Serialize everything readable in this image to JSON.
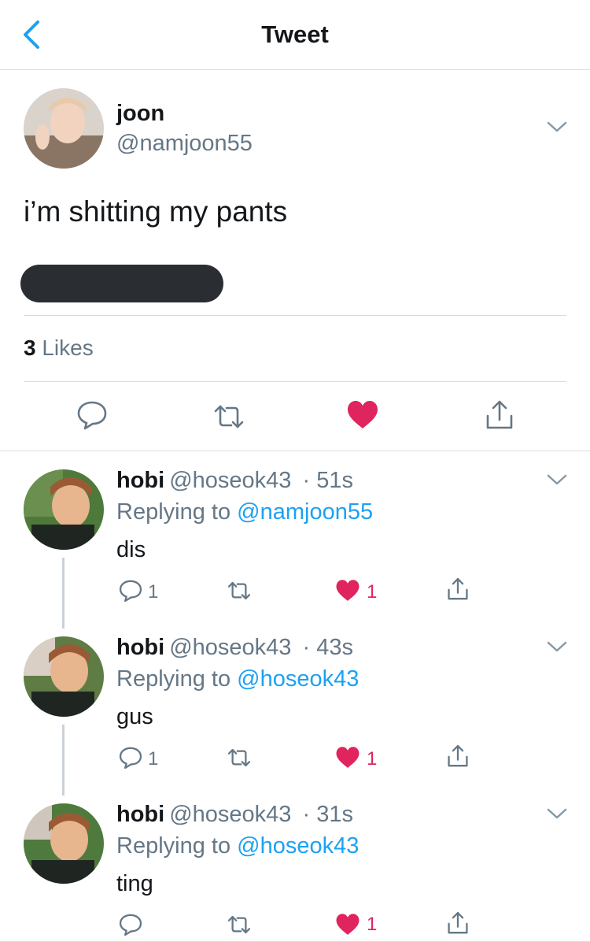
{
  "header": {
    "title": "Tweet",
    "back_icon": "chevron-left-icon"
  },
  "tweet": {
    "author_name": "joon",
    "author_handle": "@namjoon55",
    "text": "i’m shitting my pants",
    "likes_count": "3",
    "likes_label": "Likes",
    "liked": true,
    "actions": [
      "reply-icon",
      "retweet-icon",
      "heart-icon",
      "share-icon"
    ]
  },
  "replies": [
    {
      "name": "hobi",
      "handle": "@hoseok43",
      "time": "· 51s",
      "replying_label": "Replying to",
      "replying_to": "@namjoon55",
      "text": "dis",
      "reply_count": "1",
      "like_count": "1"
    },
    {
      "name": "hobi",
      "handle": "@hoseok43",
      "time": "· 43s",
      "replying_label": "Replying to",
      "replying_to": "@hoseok43",
      "text": "gus",
      "reply_count": "1",
      "like_count": "1"
    },
    {
      "name": "hobi",
      "handle": "@hoseok43",
      "time": "· 31s",
      "replying_label": "Replying to",
      "replying_to": "@hoseok43",
      "text": "ting",
      "reply_count": "",
      "like_count": "1"
    }
  ],
  "colors": {
    "accent": "#1da1f2",
    "like": "#e0245e",
    "secondary_text": "#657786"
  }
}
